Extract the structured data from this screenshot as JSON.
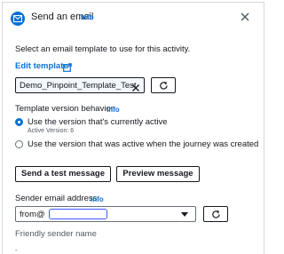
{
  "dialog": {
    "title": "Send an email",
    "title_info": "Info",
    "description": "Select an email template to use for this activity.",
    "edit_template_link": "Edit template"
  },
  "template": {
    "selected": "Demo_Pinpoint_Template_Test"
  },
  "version_behavior": {
    "label": "Template version behavior",
    "info": "Info",
    "options": [
      {
        "label": "Use the version that's currently active",
        "sub": "Active Version: 6",
        "checked": true
      },
      {
        "label": "Use the version that was active when the journey was created",
        "checked": false
      }
    ]
  },
  "actions": {
    "send_test": "Send a test message",
    "preview": "Preview message"
  },
  "sender": {
    "label": "Sender email address",
    "info": "Info",
    "value_prefix": "from@"
  },
  "friendly_sender": {
    "label": "Friendly sender name",
    "value": "-"
  },
  "colors": {
    "accent": "#0972d3",
    "text": "#16191f",
    "border": "#d5dbdb"
  },
  "icons": [
    "mail-icon",
    "close-icon",
    "external-link-icon",
    "remove-token-icon",
    "refresh-icon",
    "chevron-down-icon"
  ]
}
